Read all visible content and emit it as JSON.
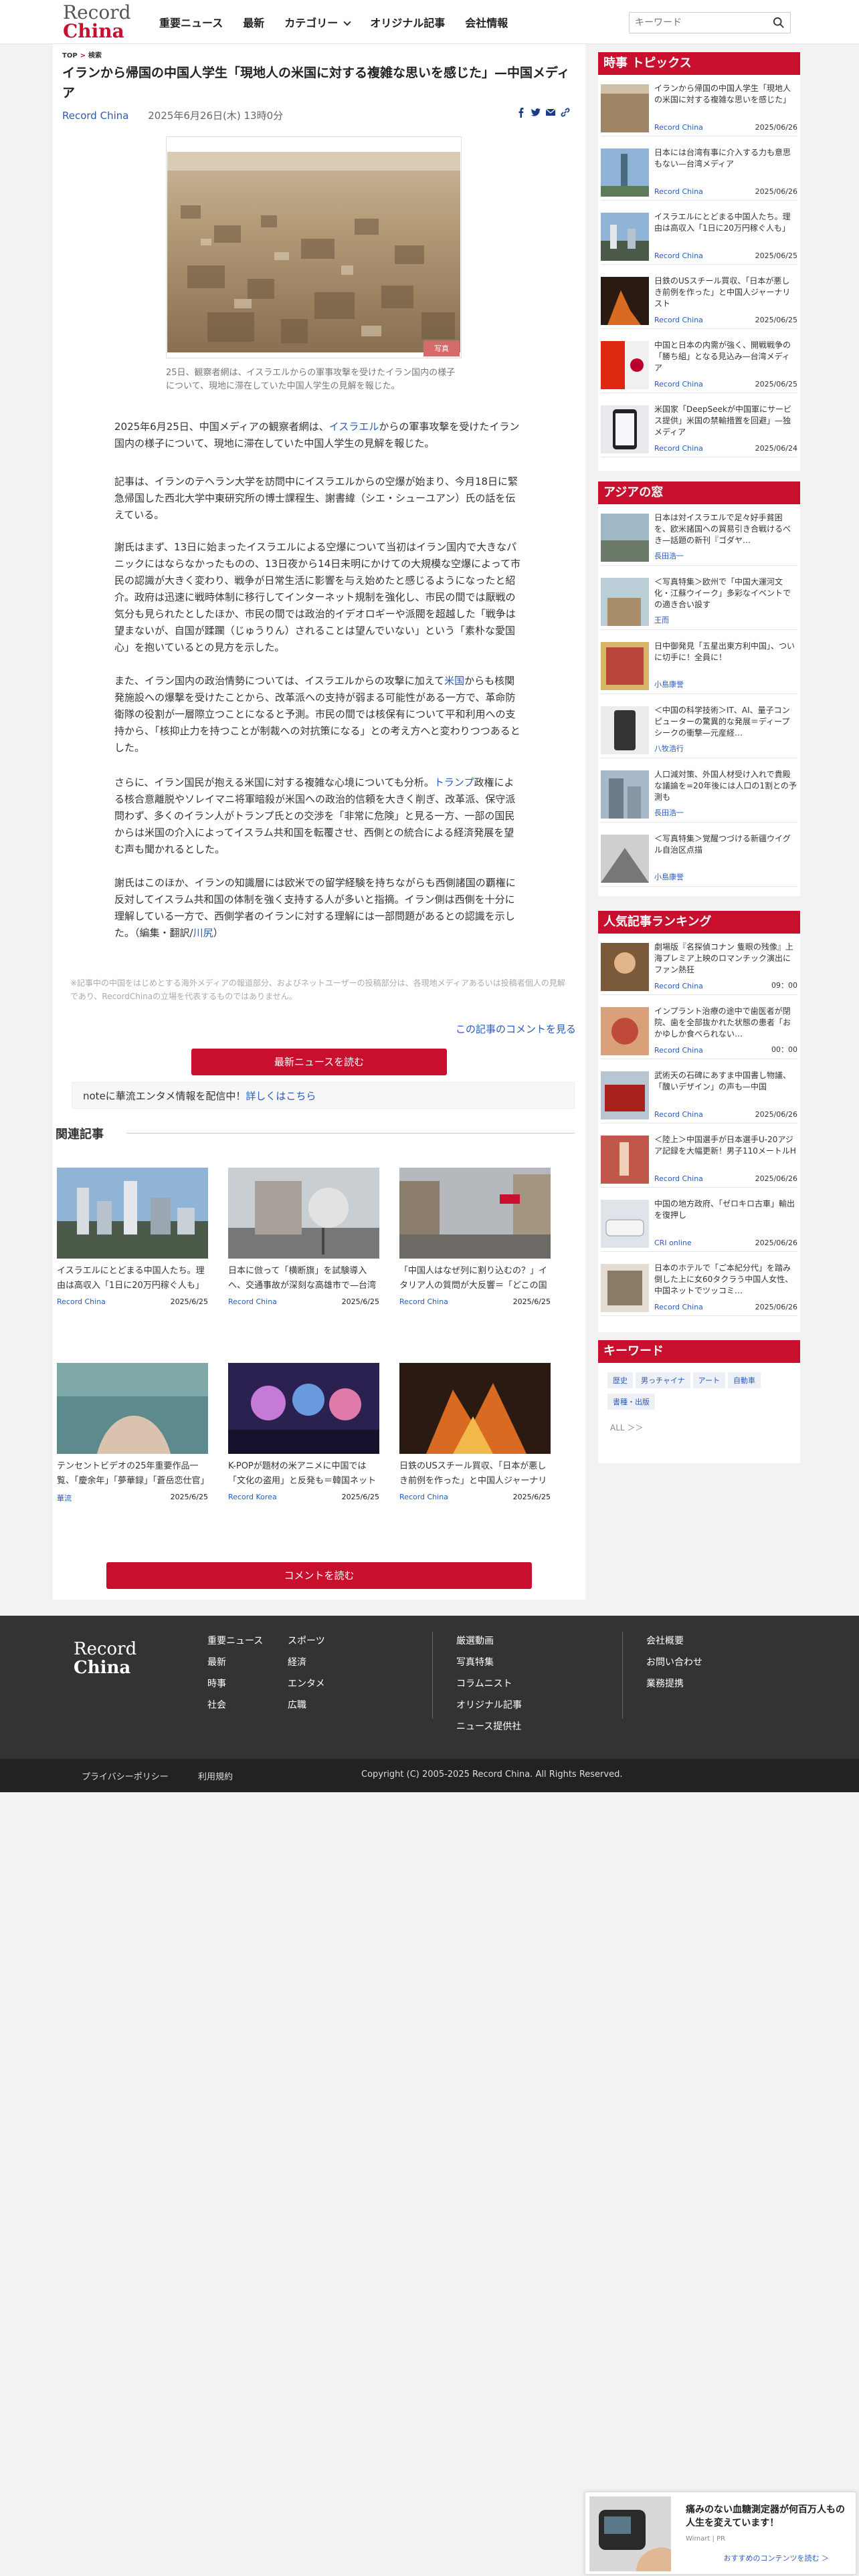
{
  "header": {
    "logo_line1": "Record",
    "logo_line2": "China",
    "nav": [
      "重要ニュース",
      "最新",
      "カテゴリー",
      "オリジナル記事",
      "会社情報"
    ],
    "search_placeholder": "キーワード"
  },
  "breadcrumb": {
    "home": "TOP",
    "current": "検索"
  },
  "article": {
    "title": "イランから帰国の中国人学生「現地人の米国に対する複雑な思いを感じた」—中国メディア",
    "source": "Record China",
    "date": "2025年6月26日(木) 13時0分",
    "caption": "25日、観察者網は、イスラエルからの軍事攻撃を受けたイラン国内の様子について、現地に滞在していた中国人学生の見解を報じた。",
    "photo_watermark": "写真",
    "p1a": "2025年6月25日、中国メディアの観察者網は、",
    "p1link": "イスラエル",
    "p1b": "からの軍事攻撃を受けたイラン国内の様子について、現地に滞在していた中国人学生の見解を報じた。",
    "p2": "記事は、イランのテヘラン大学を訪問中にイスラエルからの空爆が始まり、今月18日に緊急帰国した西北大学中東研究所の博士課程生、謝書緯（シエ・シューユアン）氏の話を伝えている。",
    "p3": "謝氏はまず、13日に始まったイスラエルによる空爆について当初はイラン国内で大きなパニックにはならなかったものの、13日夜から14日未明にかけての大規模な空爆によって市民の認識が大きく変わり、戦争が日常生活に影響を与え始めたと感じるようになったと紹介。政府は迅速に戦時体制に移行してインターネット規制を強化し、市民の間では厭戦の気分も見られたとしたほか、市民の間では政治的イデオロギーや派閥を超越した「戦争は望まないが、自国が蹂躙（じゅうりん）されることは望んでいない」という「素朴な愛国心」を抱いているとの見方を示した。",
    "p4a": "また、イラン国内の政治情勢については、イスラエルからの攻撃に加えて",
    "p4link": "米国",
    "p4b": "からも核関発施設への爆撃を受けたことから、改革派への支持が弱まる可能性がある一方で、革命防衛隊の役割が一層際立つことになると予測。市民の間では核保有について平和利用への支持から、「核抑止力を持つことが制裁への対抗策になる」との考え方へと変わりつつあるとした。",
    "p5a": "さらに、イラン国民が抱える米国に対する複雑な心境についても分析。",
    "p5link": "トランプ",
    "p5b": "政権による核合意離脱やソレイマニ将軍暗殺が米国への政治的信頼を大きく削ぎ、改革派、保守派問わず、多くのイラン人がトランプ氏との交渉を「非常に危険」と見る一方、一部の国民からは米国の介入によってイスラム共和国を転覆させ、西側との統合による経済発展を望む声も聞かれるとした。",
    "p6a": "謝氏はこのほか、イランの知識層には欧米での留学経験を持ちながらも西側諸国の覇権に反対してイスラム共和国の体制を強く支持する人が多いと指摘。イラン側は西側を十分に理解している一方で、西側学者のイランに対する理解には一部問題があるとの認識を示した。（編集・翻訳/",
    "p6link": "川尻",
    "p6b": "）",
    "note": "※記事中の中国をはじめとする海外メディアの報道部分、およびネットユーザーの投稿部分は、各現地メディアあるいは投稿者個人の見解であり、RecordChinaの立場を代表するものではありません。",
    "comment_link": "この記事のコメントを見る",
    "latest_btn": "最新ニュースを読む",
    "note_banner_a": "noteに華流エンタメ情報を配信中！",
    "note_banner_link": "詳しくはこちら",
    "comment_btn": "コメントを読む"
  },
  "related": {
    "heading": "関連記事",
    "items": [
      {
        "title": "イスラエルにとどまる中国人たち。理由は高収入「1日に20万円稼ぐ人も」—中国メディア",
        "source": "Record China",
        "date": "2025/6/25"
      },
      {
        "title": "日本に倣って「横断旗」を試験導入へ、交通事故が深刻な高雄市で—台湾メディア",
        "source": "Record China",
        "date": "2025/6/25"
      },
      {
        "title": "「中国人はなぜ列に割り込むの？」イタリア人の質問が大反響＝「どこの国でもある」「東京ディズニー…",
        "source": "Record China",
        "date": "2025/6/25"
      },
      {
        "title": "テンセントビデオの25年重要作品一覧、「慶余年」「夢華録」「蒼岳恋仕官」「異人之下」などの続編が…",
        "source": "華流",
        "date": "2025/6/25"
      },
      {
        "title": "K-POPが題材の米アニメに中国では「文化の盗用」と反発も＝韓国ネット「大事処理すぎ」",
        "source": "Record Korea",
        "date": "2025/6/25"
      },
      {
        "title": "日鉄のUSスチール買収、「日本が悪しき前例を作った」と中国人ジャーナリスト",
        "source": "Record China",
        "date": "2025/6/25"
      }
    ]
  },
  "sidebar": {
    "topics_heading": "時事 トピックス",
    "topics": [
      {
        "title": "イランから帰国の中国人学生「現地人の米国に対する複雑な思いを感じた」",
        "source": "Record China",
        "date": "2025/06/26"
      },
      {
        "title": "日本には台湾有事に介入する力も意思もない—台湾メディア",
        "source": "Record China",
        "date": "2025/06/26"
      },
      {
        "title": "イスラエルにとどまる中国人たち。理由は高収入「1日に20万円稼ぐ人も」",
        "source": "Record China",
        "date": "2025/06/25"
      },
      {
        "title": "日鉄のUSスチール買収、「日本が悪しき前例を作った」と中国人ジャーナリスト",
        "source": "Record China",
        "date": "2025/06/25"
      },
      {
        "title": "中国と日本の内需が強く、開戦戦争の「勝ち組」となる見込み—台湾メディア",
        "source": "Record China",
        "date": "2025/06/25"
      },
      {
        "title": "米国家「DeepSeekが中国軍にサービス提供」米国の禁輸措置を回避」—独メディア",
        "source": "Record China",
        "date": "2025/06/24"
      }
    ],
    "asia_heading": "アジアの窓",
    "asia": [
      {
        "title": "日本は対イスラエルで足々好手貧困を、欧米諸国への貿易引き合戦けるべき—話題の新刊『ゴダヤ…",
        "source": "長田浩一"
      },
      {
        "title": "＜写真特集＞欧州で「中国大運河文化・江蘇ウイーク」多彩なイベントでの適き合い設す",
        "source": "王而"
      },
      {
        "title": "日中御発見「五星出東方利中国」、ついに切手に！全員に！",
        "source": "小島康誉"
      },
      {
        "title": "＜中国の科学技術＞IT、AI、量子コンピューターの驚異的な発展＝ディープシークの衝撃—元産経…",
        "source": "八牧浩行"
      },
      {
        "title": "人口減対策、外国人材受け入れで貴殿な議論を=20年後には人口の1割との予測も",
        "source": "長田浩一"
      },
      {
        "title": "＜写真特集＞覚醒つづける新疆ウイグル自治区点描",
        "source": "小島康誉"
      }
    ],
    "ranking_heading": "人気記事ランキング",
    "ranking": [
      {
        "title": "劇場版『名探偵コナン 隻眼の残像』上海プレミア上映のロマンチック演出にファン熱狂",
        "source": "Record China",
        "date": "09：00"
      },
      {
        "title": "インプラント治療の途中で歯医者が閉院、歯を全部抜かれた状態の患者「おかゆしか食べられない…",
        "source": "Record China",
        "date": "00：00"
      },
      {
        "title": "武術天の石碑にあすま中国書し物議、「醜いデザイン」の声も—中国",
        "source": "Record China",
        "date": "2025/06/26"
      },
      {
        "title": "＜陸上＞中国選手が日本選手U-20アジア記録を大幅更新！男子110メートルH",
        "source": "Record China",
        "date": "2025/06/26"
      },
      {
        "title": "中国の地方政府、「ゼロキロ古車」輸出を復押し",
        "source": "CRI online",
        "date": "2025/06/26"
      },
      {
        "title": "日本のホテルで「ご本紀分代」を踏み倒した上に女60タクラう中国人女性、中国ネットでツッコミ…",
        "source": "Record China",
        "date": "2025/06/26"
      }
    ],
    "keyword_heading": "キーワード",
    "keywords": [
      "歴史",
      "男っチャイナ",
      "アート",
      "自動車",
      "書種・出版"
    ],
    "all_link": "ALL ＞＞"
  },
  "footer": {
    "logo_line1": "Record",
    "logo_line2": "China",
    "col1": [
      "重要ニュース",
      "最新",
      "時事",
      "社会"
    ],
    "col2": [
      "スポーツ",
      "経済",
      "エンタメ",
      "広職"
    ],
    "col3": [
      "厳選動画",
      "写真特集",
      "コラムニスト",
      "オリジナル記事",
      "ニュース提供社"
    ],
    "col4": [
      "会社概要",
      "お問い合わせ",
      "業務提携"
    ],
    "privacy": "プライバシーポリシー",
    "terms": "利用規約",
    "copyright": "Copyright (C) 2005-2025 Record China. All Rights Reserved."
  },
  "ad": {
    "title": "痛みのない血糖測定器が何百万人もの人生を変えています！",
    "source": "Wimart | PR",
    "cta": "おすすめのコンテンツを読む ＞"
  },
  "colors": {
    "brand": "#c8102e",
    "link": "#2a5bb7",
    "footer": "#333333"
  }
}
